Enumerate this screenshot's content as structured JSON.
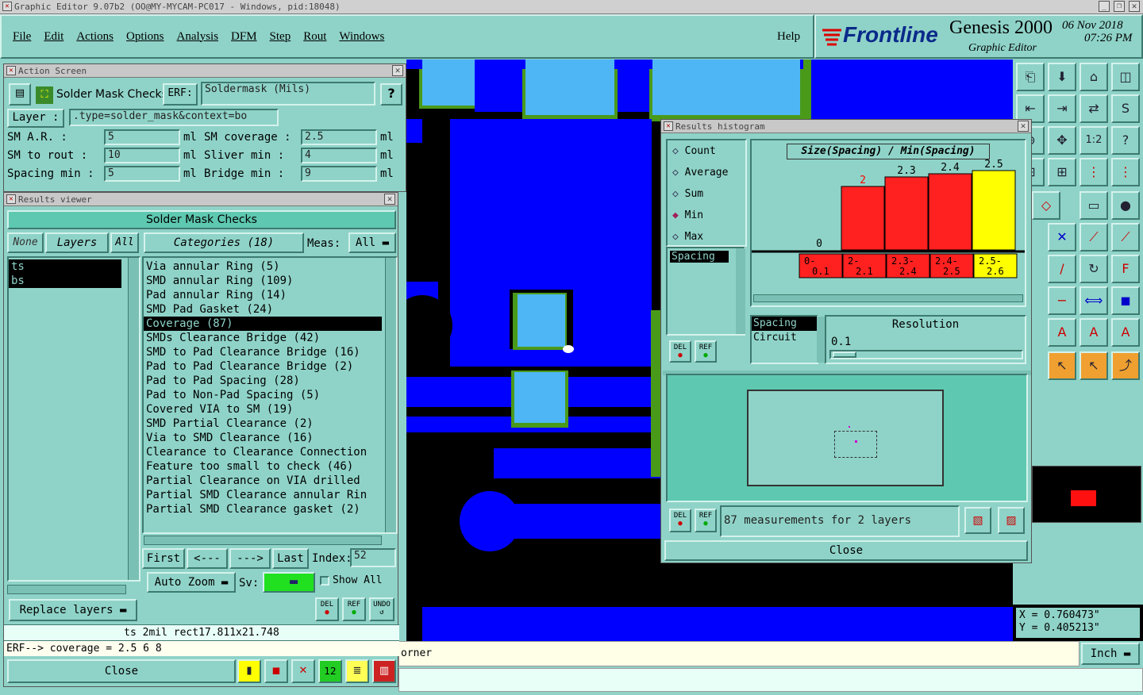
{
  "window_title": "Graphic Editor 9.07b2 (OO@MY-MYCAM-PC017 - Windows, pid:18048)",
  "menu": [
    "File",
    "Edit",
    "Actions",
    "Options",
    "Analysis",
    "DFM",
    "Step",
    "Rout",
    "Windows"
  ],
  "menu_help": "Help",
  "brand": {
    "logo": "Frontline",
    "product": "Genesis 2000",
    "subtitle": "Graphic Editor",
    "date": "06 Nov 2018",
    "time": "07:26 PM"
  },
  "action_screen": {
    "title": "Action Screen",
    "check_name": "Solder Mask Checks",
    "erf_label": "ERF:",
    "erf_value": "Soldermask (Mils)",
    "help": "?",
    "layer_label": "Layer :",
    "layer_value": ".type=solder_mask&context=bo",
    "params": [
      {
        "label": "SM A.R.      :",
        "value": "5",
        "unit": "ml"
      },
      {
        "label": "SM coverage  :",
        "value": "2.5",
        "unit": "ml"
      },
      {
        "label": "SM to rout   :",
        "value": "10",
        "unit": "ml"
      },
      {
        "label": "Sliver  min  :",
        "value": "4",
        "unit": "ml"
      },
      {
        "label": "Spacing min  :",
        "value": "5",
        "unit": "ml"
      },
      {
        "label": "Bridge  min  :",
        "value": "9",
        "unit": "ml"
      }
    ]
  },
  "results_viewer": {
    "title": "Results viewer",
    "header": "Solder Mask Checks",
    "none": "None",
    "layers_tab": "Layers",
    "all": "All",
    "categories_label": "Categories (18)",
    "meas_label": "Meas:",
    "meas_value": "All",
    "layers": [
      "ts",
      "bs"
    ],
    "categories": [
      "Via annular Ring (5)",
      "SMD annular Ring (109)",
      "Pad annular Ring (14)",
      "SMD Pad Gasket (24)",
      "Coverage (87)",
      "SMDs Clearance Bridge (42)",
      "SMD to Pad Clearance Bridge (16)",
      "Pad to Pad Clearance Bridge (2)",
      "Pad to Pad Spacing (28)",
      "Pad to Non-Pad Spacing (5)",
      "Covered VIA to SM (19)",
      "SMD Partial Clearance (2)",
      "Via to SMD Clearance (16)",
      "Clearance to Clearance Connection",
      "Feature too small to check (46)",
      "Partial Clearance on VIA drilled",
      "Partial SMD Clearance annular Rin",
      "Partial SMD Clearance gasket (2)"
    ],
    "selected_category": 4,
    "nav": {
      "first": "First",
      "prev": "<---",
      "next": "--->",
      "last": "Last",
      "index_label": "Index:",
      "index_value": "52"
    },
    "auto_zoom": "Auto Zoom",
    "sv_label": "Sv:",
    "show_all": "Show All",
    "replace_layers": "Replace layers",
    "del": "DEL",
    "ref": "REF",
    "undo": "UNDO",
    "status1": "ts 2mil  rect17.811x21.748",
    "status2": "ERF--> coverage = 2.5 6 8",
    "close": "Close"
  },
  "histogram": {
    "title": "Results histogram",
    "modes": [
      "Count",
      "Average",
      "Sum",
      "Min",
      "Max"
    ],
    "selected_mode": "Min",
    "measure_list": [
      "Spacing"
    ],
    "del": "DEL",
    "ref": "REF",
    "chart_title": "Size(Spacing) / Min(Spacing)",
    "spacing_circuit": [
      "Spacing",
      "Circuit"
    ],
    "resolution_label": "Resolution",
    "resolution_value": "0.1",
    "summary": "87 measurements for 2 layers",
    "close": "Close",
    "red": "#ff2020",
    "yellow": "#ffff00"
  },
  "chart_data": {
    "type": "bar",
    "title": "Size(Spacing) / Min(Spacing)",
    "categories": [
      "0-0.1",
      "2-2.1",
      "2.3-2.4",
      "2.4-2.5",
      "2.5-2.6"
    ],
    "values": [
      0,
      2,
      2.3,
      2.4,
      2.5
    ],
    "value_labels": [
      "0",
      "2",
      "2.3",
      "2.4",
      "2.5"
    ],
    "ylim": [
      0,
      2.6
    ],
    "colors": [
      "#ff2020",
      "#ff2020",
      "#ff2020",
      "#ff2020",
      "#ffff00"
    ]
  },
  "coords": {
    "x": "X = 0.760473\"",
    "y": "Y = 0.405213\""
  },
  "units": "Inch",
  "status_corner": "orner"
}
